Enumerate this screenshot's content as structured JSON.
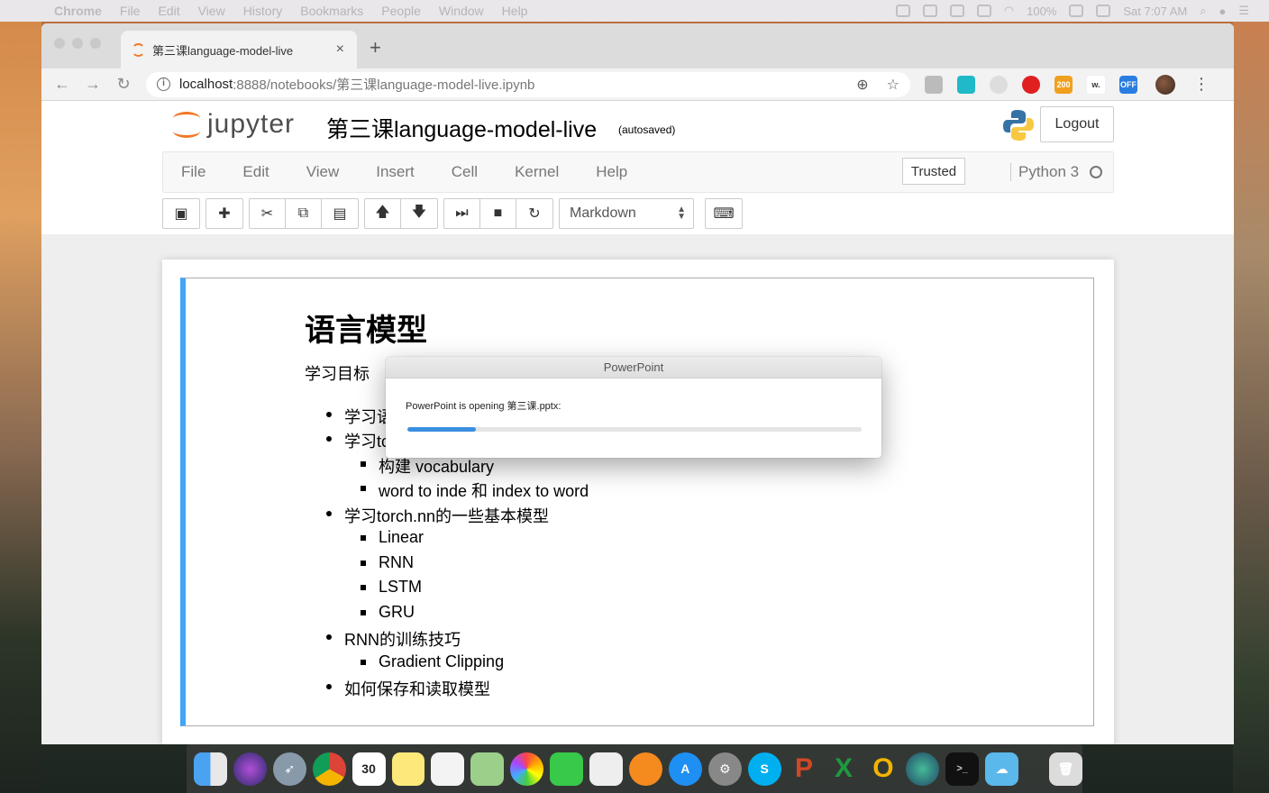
{
  "menubar": {
    "apple": "",
    "items": [
      "Chrome",
      "File",
      "Edit",
      "View",
      "History",
      "Bookmarks",
      "People",
      "Window",
      "Help"
    ],
    "battery": "100%",
    "clock": "Sat 7:07 AM"
  },
  "browser": {
    "tab_title": "第三课language-model-live",
    "tab_close": "×",
    "new_tab": "+",
    "url_host": "localhost",
    "url_rest": ":8888/notebooks/第三课language-model-live.ipynb",
    "ext_badges": [
      "200",
      "w.",
      "OFF"
    ]
  },
  "jupyter": {
    "logo_text": "jupyter",
    "notebook_title": "第三课language-model-live",
    "autosave_status": "(autosaved)",
    "logout_label": "Logout",
    "menu": [
      "File",
      "Edit",
      "View",
      "Insert",
      "Cell",
      "Kernel",
      "Help"
    ],
    "trusted_label": "Trusted",
    "kernel_name": "Python 3",
    "cell_type": "Markdown"
  },
  "cell": {
    "heading": "语言模型",
    "goal_label": "学习目标",
    "bullets": [
      {
        "level": 1,
        "text": "学习语"
      },
      {
        "level": 1,
        "text": "学习tc"
      },
      {
        "level": 2,
        "text": "构建 vocabulary"
      },
      {
        "level": 2,
        "text": "word to inde 和 index to word"
      },
      {
        "level": 1,
        "text": "学习torch.nn的一些基本模型"
      },
      {
        "level": 2,
        "text": "Linear"
      },
      {
        "level": 2,
        "text": "RNN"
      },
      {
        "level": 2,
        "text": "LSTM"
      },
      {
        "level": 2,
        "text": "GRU"
      },
      {
        "level": 1,
        "text": "RNN的训练技巧"
      },
      {
        "level": 2,
        "text": "Gradient Clipping"
      },
      {
        "level": 1,
        "text": "如何保存和读取模型"
      }
    ]
  },
  "dialog": {
    "title": "PowerPoint",
    "message": "PowerPoint is opening 第三课.pptx:",
    "progress": 0.15
  },
  "dock": {
    "calendar_day": "30"
  }
}
